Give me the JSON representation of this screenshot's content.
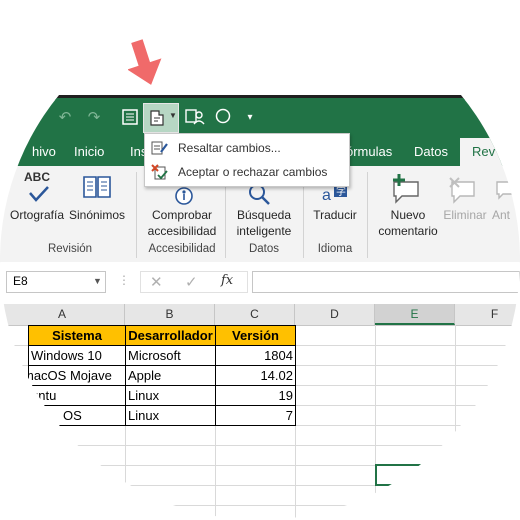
{
  "quick_access": {
    "active_icon": "track-changes-icon"
  },
  "dropdown": {
    "items": [
      {
        "label": "Resaltar cambios..."
      },
      {
        "label": "Aceptar o rechazar cambios"
      }
    ]
  },
  "tabs": [
    {
      "label": "hivo"
    },
    {
      "label": "Inicio"
    },
    {
      "label": "Ins"
    },
    {
      "label": "órmulas"
    },
    {
      "label": "Datos"
    },
    {
      "label": "Rev"
    }
  ],
  "ribbon": {
    "ortografia": "Ortografía",
    "sinonimos": "Sinónimos",
    "abc": "ABC",
    "group_revision": "Revisión",
    "comprobar_line1": "Comprobar",
    "comprobar_line2": "accesibilidad",
    "group_accesibilidad": "Accesibilidad",
    "busqueda_line1": "Búsqueda",
    "busqueda_line2": "inteligente",
    "group_datos": "Datos",
    "traducir": "Traducir",
    "group_idioma": "Idioma",
    "nuevo_line1": "Nuevo",
    "nuevo_line2": "comentario",
    "eliminar": "Eliminar",
    "anterior": "Ant"
  },
  "formula_bar": {
    "name_box": "E8",
    "fx": "fx",
    "formula": ""
  },
  "columns": [
    "A",
    "B",
    "C",
    "D",
    "E",
    "F"
  ],
  "table": {
    "headers": [
      "Sistema",
      "Desarrollador",
      "Versión"
    ],
    "rows": [
      [
        "Windows 10",
        "Microsoft",
        "1804"
      ],
      [
        "macOS Mojave",
        "Apple",
        "14.02"
      ],
      [
        "untu",
        "Linux",
        "19"
      ],
      [
        "OS",
        "Linux",
        "7"
      ]
    ]
  },
  "colors": {
    "excel_green": "#217346",
    "header_fill": "#ffc000",
    "arrow": "#f06060"
  }
}
